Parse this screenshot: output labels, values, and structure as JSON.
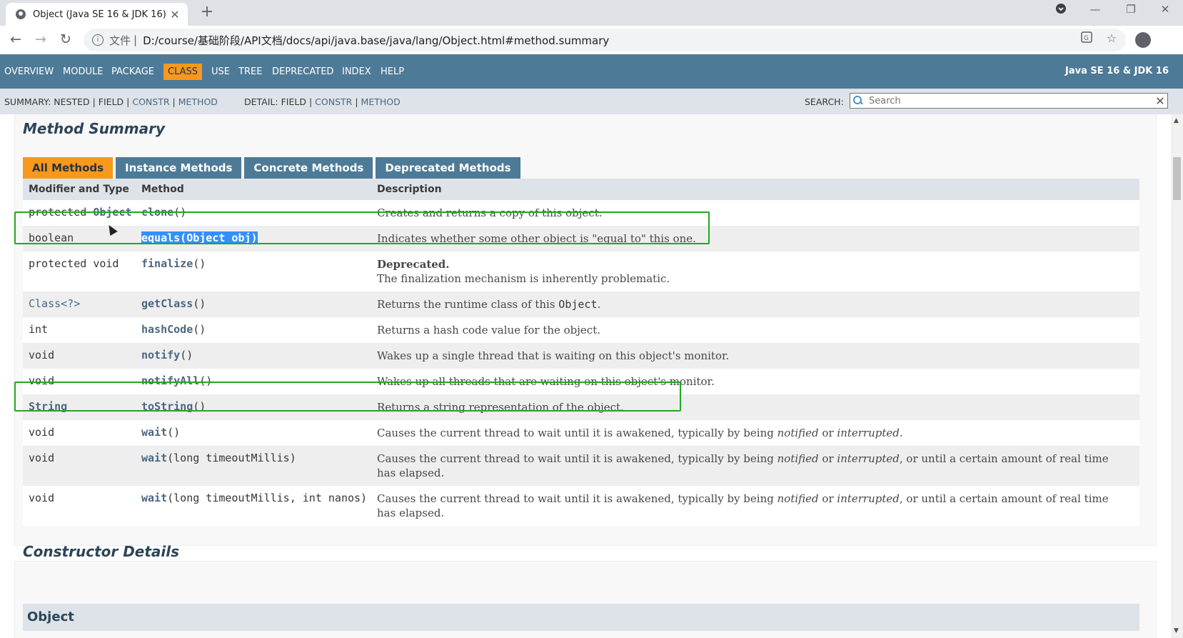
{
  "browser": {
    "tab_title": "Object (Java SE 16 & JDK 16)",
    "tab_close": "✕",
    "new_tab": "+",
    "url_scheme": "文件",
    "url_sep": "|",
    "url": "D:/course/基础阶段/API文档/docs/api/java.base/java/lang/Object.html#method.summary",
    "back": "←",
    "forward": "→",
    "reload": "↻",
    "minimize": "—",
    "restore": "❐",
    "close": "✕"
  },
  "javadoc_nav": {
    "items": [
      "OVERVIEW",
      "MODULE",
      "PACKAGE",
      "CLASS",
      "USE",
      "TREE",
      "DEPRECATED",
      "INDEX",
      "HELP"
    ],
    "active": "CLASS",
    "title": "Java SE 16 & JDK 16"
  },
  "subnav": {
    "summary_prefix": "SUMMARY:",
    "summary_nested": "NESTED",
    "summary_field": "FIELD",
    "summary_constr": "CONSTR",
    "summary_method": "METHOD",
    "detail_prefix": "DETAIL:",
    "detail_field": "FIELD",
    "detail_constr": "CONSTR",
    "detail_method": "METHOD",
    "sep": "|",
    "search_label": "SEARCH:",
    "search_placeholder": "Search",
    "search_reset": "✕"
  },
  "method_summary": {
    "heading": "Method Summary",
    "tabs": [
      "All Methods",
      "Instance Methods",
      "Concrete Methods",
      "Deprecated Methods"
    ],
    "active_tab": "All Methods",
    "columns": [
      "Modifier and Type",
      "Method",
      "Description"
    ],
    "rows": [
      {
        "modifier": "protected",
        "type": "Object",
        "method": "clone",
        "params": "()",
        "desc": "Creates and returns a copy of this object."
      },
      {
        "modifier": "",
        "type": "boolean",
        "method": "equals(Object obj)",
        "params": "",
        "desc": "Indicates whether some other object is \"equal to\" this one."
      },
      {
        "modifier": "protected",
        "type": "void",
        "method": "finalize",
        "params": "()",
        "desc_bold": "Deprecated.",
        "desc": "The finalization mechanism is inherently problematic."
      },
      {
        "modifier": "",
        "type": "Class<?>",
        "method": "getClass",
        "params": "()",
        "desc_pre": "Returns the runtime class of this ",
        "desc_code": "Object",
        "desc_post": "."
      },
      {
        "modifier": "",
        "type": "int",
        "method": "hashCode",
        "params": "()",
        "desc": "Returns a hash code value for the object."
      },
      {
        "modifier": "",
        "type": "void",
        "method": "notify",
        "params": "()",
        "desc": "Wakes up a single thread that is waiting on this object's monitor."
      },
      {
        "modifier": "",
        "type": "void",
        "method": "notifyAll",
        "params": "()",
        "desc": "Wakes up all threads that are waiting on this object's monitor."
      },
      {
        "modifier": "",
        "type": "String",
        "method": "toString",
        "params": "()",
        "desc": "Returns a string representation of the object."
      },
      {
        "modifier": "",
        "type": "void",
        "method": "wait",
        "params": "()",
        "desc_a": "Causes the current thread to wait until it is awakened, typically by being ",
        "em1": "notified",
        "or": " or ",
        "em2": "interrupted",
        "desc_b": "."
      },
      {
        "modifier": "",
        "type": "void",
        "method": "wait",
        "params": "(long timeoutMillis)",
        "desc_a": "Causes the current thread to wait until it is awakened, typically by being ",
        "em1": "notified",
        "or": " or ",
        "em2": "interrupted",
        "desc_b": ", or until a certain amount of real time has elapsed."
      },
      {
        "modifier": "",
        "type": "void",
        "method": "wait",
        "params": "(long timeoutMillis, int nanos)",
        "desc_a": "Causes the current thread to wait until it is awakened, typically by being ",
        "em1": "notified",
        "or": " or ",
        "em2": "interrupted",
        "desc_b": ", or until a certain amount of real time has elapsed."
      }
    ]
  },
  "constructor_details": {
    "heading": "Constructor Details",
    "first": "Object"
  }
}
